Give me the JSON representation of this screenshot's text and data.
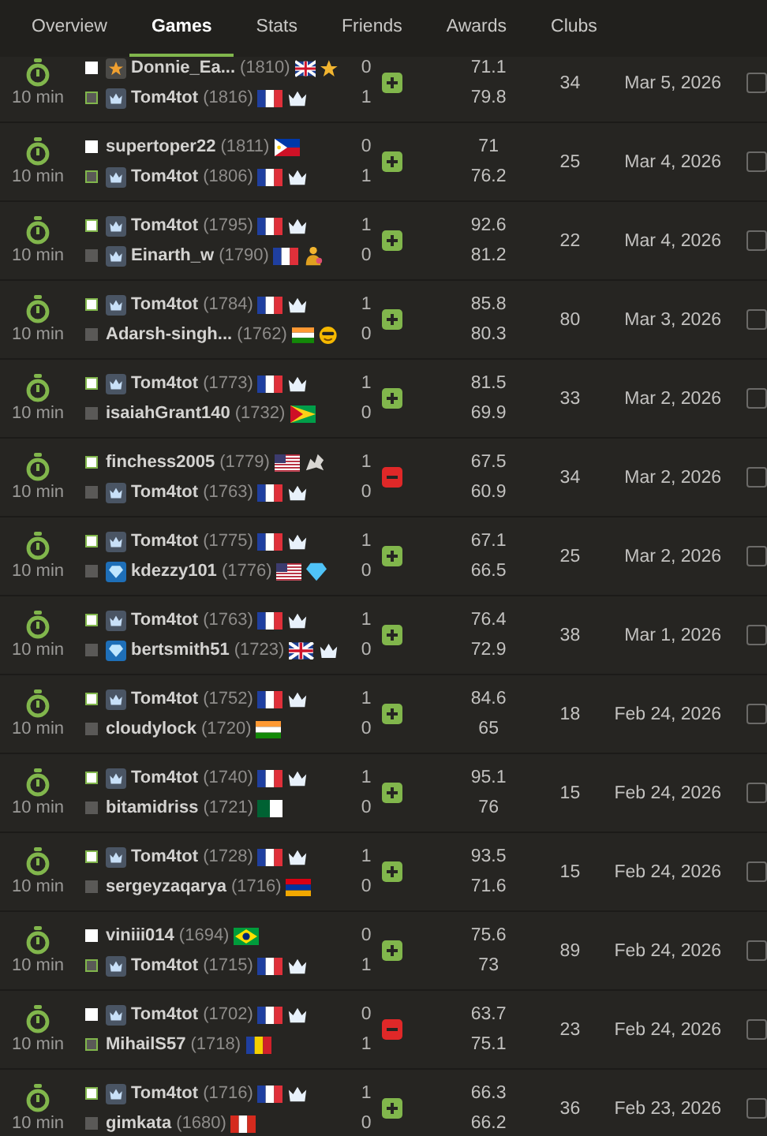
{
  "tabs": [
    {
      "label": "Overview",
      "selected": false
    },
    {
      "label": "Games",
      "selected": true
    },
    {
      "label": "Stats",
      "selected": false
    },
    {
      "label": "Friends",
      "selected": false
    },
    {
      "label": "Awards",
      "selected": false
    },
    {
      "label": "Clubs",
      "selected": false
    }
  ],
  "rows": [
    {
      "time": "10 min",
      "players": [
        {
          "name": "Donnie_Ea...",
          "rating": "(1810)",
          "white": true,
          "winner": false,
          "badge": {
            "kind": "star"
          },
          "flag": {
            "kind": "gb"
          },
          "extra": {
            "kind": "star"
          },
          "score": "0"
        },
        {
          "name": "Tom4tot",
          "rating": "(1816)",
          "white": false,
          "winner": true,
          "badge": {
            "kind": "crown"
          },
          "flag": {
            "kind": "fr"
          },
          "extra": {
            "kind": "crown"
          },
          "score": "1"
        }
      ],
      "result": {
        "kind": "win"
      },
      "accuracy": [
        "71.1",
        "79.8"
      ],
      "moves": "34",
      "date": "Mar 5, 2026",
      "checked": false
    },
    {
      "time": "10 min",
      "players": [
        {
          "name": "supertoper22",
          "rating": "(1811)",
          "white": true,
          "winner": false,
          "flag": {
            "kind": "ph"
          },
          "score": "0"
        },
        {
          "name": "Tom4tot",
          "rating": "(1806)",
          "white": false,
          "winner": true,
          "badge": {
            "kind": "crown"
          },
          "flag": {
            "kind": "fr"
          },
          "extra": {
            "kind": "crown"
          },
          "score": "1"
        }
      ],
      "result": {
        "kind": "win"
      },
      "accuracy": [
        "71",
        "76.2"
      ],
      "moves": "25",
      "date": "Mar 4, 2026",
      "checked": false
    },
    {
      "time": "10 min",
      "players": [
        {
          "name": "Tom4tot",
          "rating": "(1795)",
          "white": true,
          "winner": true,
          "badge": {
            "kind": "crown"
          },
          "flag": {
            "kind": "fr"
          },
          "extra": {
            "kind": "crown"
          },
          "score": "1"
        },
        {
          "name": "Einarth_w",
          "rating": "(1790)",
          "white": false,
          "winner": false,
          "badge": {
            "kind": "crown"
          },
          "flag": {
            "kind": "fr"
          },
          "extra": {
            "kind": "person"
          },
          "score": "0"
        }
      ],
      "result": {
        "kind": "win"
      },
      "accuracy": [
        "92.6",
        "81.2"
      ],
      "moves": "22",
      "date": "Mar 4, 2026",
      "checked": false
    },
    {
      "time": "10 min",
      "players": [
        {
          "name": "Tom4tot",
          "rating": "(1784)",
          "white": true,
          "winner": true,
          "badge": {
            "kind": "crown"
          },
          "flag": {
            "kind": "fr"
          },
          "extra": {
            "kind": "crown"
          },
          "score": "1"
        },
        {
          "name": "Adarsh-singh...",
          "rating": "(1762)",
          "white": false,
          "winner": false,
          "flag": {
            "kind": "in"
          },
          "extra": {
            "kind": "smiley"
          },
          "score": "0"
        }
      ],
      "result": {
        "kind": "win"
      },
      "accuracy": [
        "85.8",
        "80.3"
      ],
      "moves": "80",
      "date": "Mar 3, 2026",
      "checked": false
    },
    {
      "time": "10 min",
      "players": [
        {
          "name": "Tom4tot",
          "rating": "(1773)",
          "white": true,
          "winner": true,
          "badge": {
            "kind": "crown"
          },
          "flag": {
            "kind": "fr"
          },
          "extra": {
            "kind": "crown"
          },
          "score": "1"
        },
        {
          "name": "isaiahGrant140",
          "rating": "(1732)",
          "white": false,
          "winner": false,
          "flag": {
            "kind": "gy"
          },
          "score": "0"
        }
      ],
      "result": {
        "kind": "win"
      },
      "accuracy": [
        "81.5",
        "69.9"
      ],
      "moves": "33",
      "date": "Mar 2, 2026",
      "checked": false
    },
    {
      "time": "10 min",
      "players": [
        {
          "name": "finchess2005",
          "rating": "(1779)",
          "white": true,
          "winner": true,
          "flag": {
            "kind": "us"
          },
          "extra": {
            "kind": "dragon"
          },
          "score": "1"
        },
        {
          "name": "Tom4tot",
          "rating": "(1763)",
          "white": false,
          "winner": false,
          "badge": {
            "kind": "crown"
          },
          "flag": {
            "kind": "fr"
          },
          "extra": {
            "kind": "crown"
          },
          "score": "0"
        }
      ],
      "result": {
        "kind": "loss"
      },
      "accuracy": [
        "67.5",
        "60.9"
      ],
      "moves": "34",
      "date": "Mar 2, 2026",
      "checked": false
    },
    {
      "time": "10 min",
      "players": [
        {
          "name": "Tom4tot",
          "rating": "(1775)",
          "white": true,
          "winner": true,
          "badge": {
            "kind": "crown"
          },
          "flag": {
            "kind": "fr"
          },
          "extra": {
            "kind": "crown"
          },
          "score": "1"
        },
        {
          "name": "kdezzy101",
          "rating": "(1776)",
          "white": false,
          "winner": false,
          "badge": {
            "kind": "diamond"
          },
          "flag": {
            "kind": "us"
          },
          "extra": {
            "kind": "diamond"
          },
          "score": "0"
        }
      ],
      "result": {
        "kind": "win"
      },
      "accuracy": [
        "67.1",
        "66.5"
      ],
      "moves": "25",
      "date": "Mar 2, 2026",
      "checked": false
    },
    {
      "time": "10 min",
      "players": [
        {
          "name": "Tom4tot",
          "rating": "(1763)",
          "white": true,
          "winner": true,
          "badge": {
            "kind": "crown"
          },
          "flag": {
            "kind": "fr"
          },
          "extra": {
            "kind": "crown"
          },
          "score": "1"
        },
        {
          "name": "bertsmith51",
          "rating": "(1723)",
          "white": false,
          "winner": false,
          "badge": {
            "kind": "diamond"
          },
          "flag": {
            "kind": "gb"
          },
          "extra": {
            "kind": "crown"
          },
          "score": "0"
        }
      ],
      "result": {
        "kind": "win"
      },
      "accuracy": [
        "76.4",
        "72.9"
      ],
      "moves": "38",
      "date": "Mar 1, 2026",
      "checked": false
    },
    {
      "time": "10 min",
      "players": [
        {
          "name": "Tom4tot",
          "rating": "(1752)",
          "white": true,
          "winner": true,
          "badge": {
            "kind": "crown"
          },
          "flag": {
            "kind": "fr"
          },
          "extra": {
            "kind": "crown"
          },
          "score": "1"
        },
        {
          "name": "cloudylock",
          "rating": "(1720)",
          "white": false,
          "winner": false,
          "flag": {
            "kind": "in"
          },
          "score": "0"
        }
      ],
      "result": {
        "kind": "win"
      },
      "accuracy": [
        "84.6",
        "65"
      ],
      "moves": "18",
      "date": "Feb 24, 2026",
      "checked": false
    },
    {
      "time": "10 min",
      "players": [
        {
          "name": "Tom4tot",
          "rating": "(1740)",
          "white": true,
          "winner": true,
          "badge": {
            "kind": "crown"
          },
          "flag": {
            "kind": "fr"
          },
          "extra": {
            "kind": "crown"
          },
          "score": "1"
        },
        {
          "name": "bitamidriss",
          "rating": "(1721)",
          "white": false,
          "winner": false,
          "flag": {
            "kind": "dz"
          },
          "score": "0"
        }
      ],
      "result": {
        "kind": "win"
      },
      "accuracy": [
        "95.1",
        "76"
      ],
      "moves": "15",
      "date": "Feb 24, 2026",
      "checked": false
    },
    {
      "time": "10 min",
      "players": [
        {
          "name": "Tom4tot",
          "rating": "(1728)",
          "white": true,
          "winner": true,
          "badge": {
            "kind": "crown"
          },
          "flag": {
            "kind": "fr"
          },
          "extra": {
            "kind": "crown"
          },
          "score": "1"
        },
        {
          "name": "sergeyzaqarya",
          "rating": "(1716)",
          "white": false,
          "winner": false,
          "flag": {
            "kind": "am"
          },
          "score": "0"
        }
      ],
      "result": {
        "kind": "win"
      },
      "accuracy": [
        "93.5",
        "71.6"
      ],
      "moves": "15",
      "date": "Feb 24, 2026",
      "checked": false
    },
    {
      "time": "10 min",
      "players": [
        {
          "name": "viniii014",
          "rating": "(1694)",
          "white": true,
          "winner": false,
          "flag": {
            "kind": "br"
          },
          "score": "0"
        },
        {
          "name": "Tom4tot",
          "rating": "(1715)",
          "white": false,
          "winner": true,
          "badge": {
            "kind": "crown"
          },
          "flag": {
            "kind": "fr"
          },
          "extra": {
            "kind": "crown"
          },
          "score": "1"
        }
      ],
      "result": {
        "kind": "win"
      },
      "accuracy": [
        "75.6",
        "73"
      ],
      "moves": "89",
      "date": "Feb 24, 2026",
      "checked": false
    },
    {
      "time": "10 min",
      "players": [
        {
          "name": "Tom4tot",
          "rating": "(1702)",
          "white": true,
          "winner": false,
          "badge": {
            "kind": "crown"
          },
          "flag": {
            "kind": "fr"
          },
          "extra": {
            "kind": "crown"
          },
          "score": "0"
        },
        {
          "name": "MihailS57",
          "rating": "(1718)",
          "white": false,
          "winner": true,
          "flag": {
            "kind": "ro"
          },
          "score": "1"
        }
      ],
      "result": {
        "kind": "loss"
      },
      "accuracy": [
        "63.7",
        "75.1"
      ],
      "moves": "23",
      "date": "Feb 24, 2026",
      "checked": false
    },
    {
      "time": "10 min",
      "players": [
        {
          "name": "Tom4tot",
          "rating": "(1716)",
          "white": true,
          "winner": true,
          "badge": {
            "kind": "crown"
          },
          "flag": {
            "kind": "fr"
          },
          "extra": {
            "kind": "crown"
          },
          "score": "1"
        },
        {
          "name": "gimkata",
          "rating": "(1680)",
          "white": false,
          "winner": false,
          "flag": {
            "kind": "pe"
          },
          "score": "0"
        }
      ],
      "result": {
        "kind": "win"
      },
      "accuracy": [
        "66.3",
        "66.2"
      ],
      "moves": "36",
      "date": "Feb 23, 2026",
      "checked": false
    }
  ]
}
